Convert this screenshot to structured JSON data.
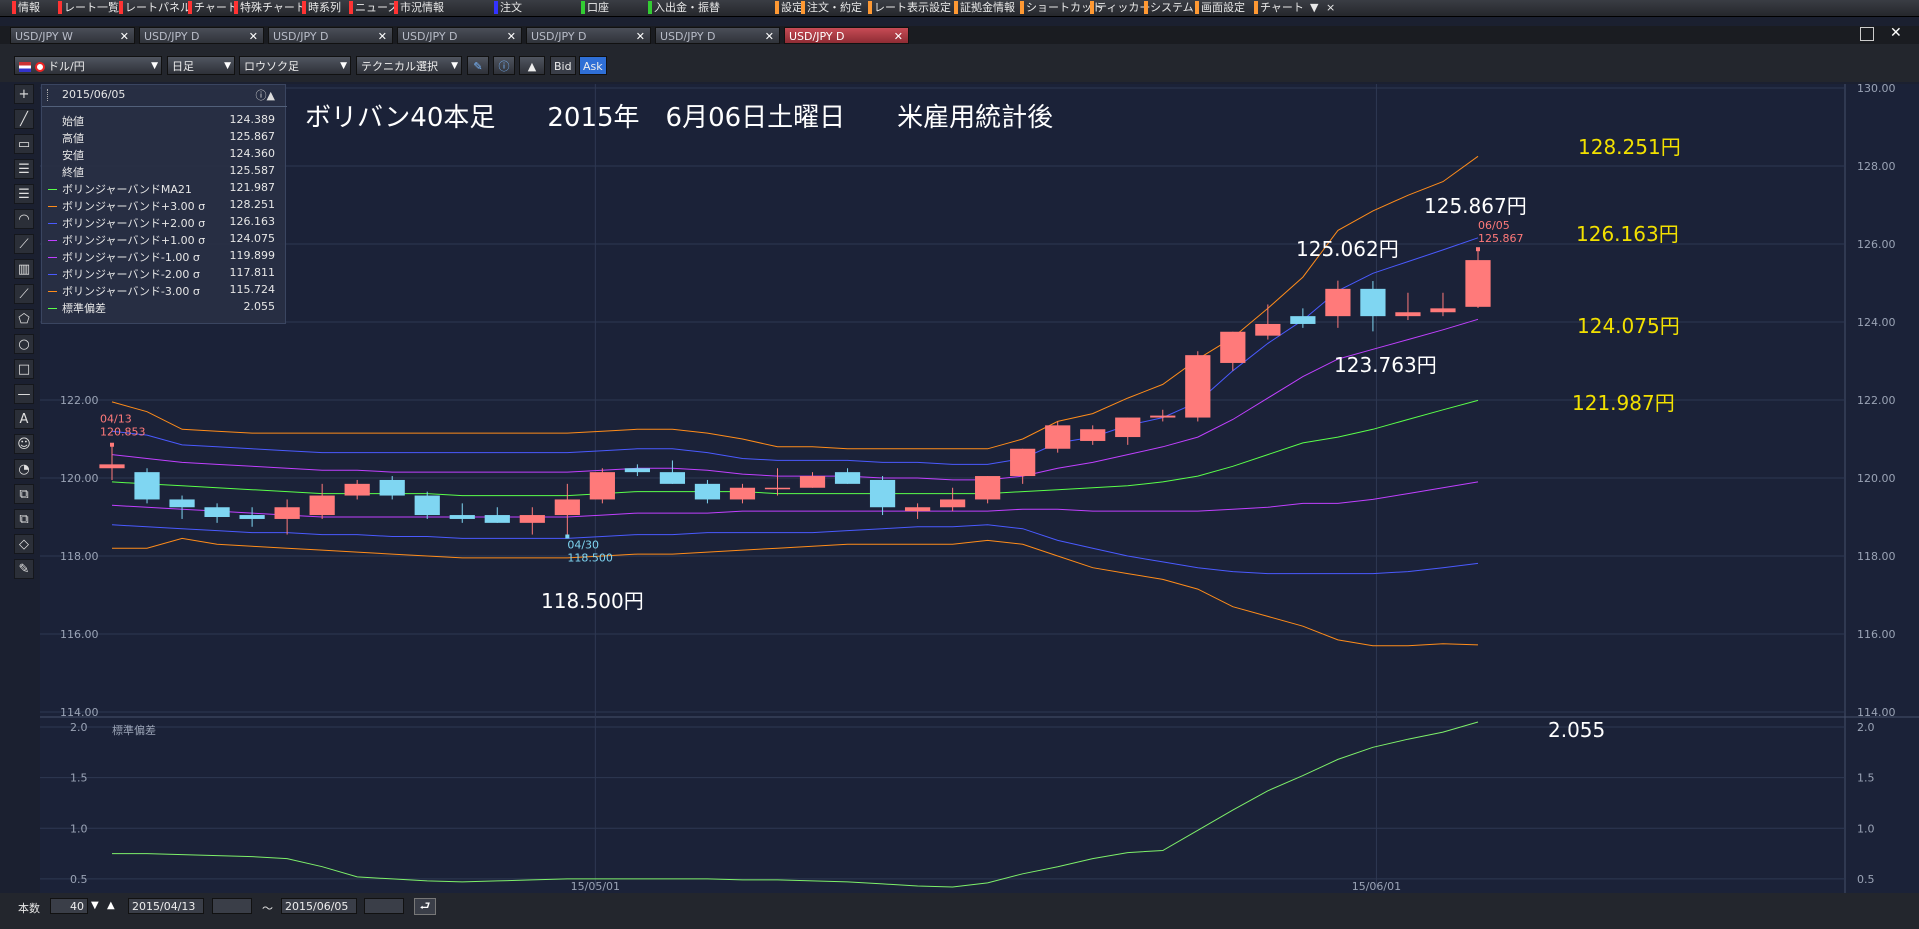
{
  "menubar": {
    "items": [
      "情報",
      "レート一覧",
      "レートパネル",
      "チャート",
      "特殊チャート",
      "時系列",
      "ニュース",
      "市況情報",
      "注文",
      "口座",
      "入出金・振替",
      "設定",
      "注文・約定",
      "レート表示設定",
      "証拠金情報",
      "ショートカット",
      "ティッカー",
      "システム",
      "画面設定",
      "チャート"
    ],
    "more_arrow": "▼",
    "close_glyph": "×"
  },
  "tabs": [
    {
      "label": "USD/JPY W"
    },
    {
      "label": "USD/JPY D"
    },
    {
      "label": "USD/JPY D"
    },
    {
      "label": "USD/JPY D"
    },
    {
      "label": "USD/JPY D"
    },
    {
      "label": "USD/JPY D"
    },
    {
      "label": "USD/JPY D",
      "active": true
    }
  ],
  "toolbar": {
    "pair": "ドル/円",
    "interval": "日足",
    "chart_type": "ロウソク足",
    "technical": "テクニカル選択",
    "bid_label": "Bid",
    "ask_label": "Ask"
  },
  "info": {
    "date": "2015/06/05",
    "rows": [
      {
        "key": "始値",
        "val": "124.389",
        "color": ""
      },
      {
        "key": "高値",
        "val": "125.867",
        "color": ""
      },
      {
        "key": "安値",
        "val": "124.360",
        "color": ""
      },
      {
        "key": "終値",
        "val": "125.587",
        "color": ""
      },
      {
        "key": "ボリンジャーバンドMA21",
        "val": "121.987",
        "color": "#5aff4a"
      },
      {
        "key": "ボリンジャーバンド+3.00 σ",
        "val": "128.251",
        "color": "#ff8c1a"
      },
      {
        "key": "ボリンジャーバンド+2.00 σ",
        "val": "126.163",
        "color": "#4a5aff"
      },
      {
        "key": "ボリンジャーバンド+1.00 σ",
        "val": "124.075",
        "color": "#c040ff"
      },
      {
        "key": "ボリンジャーバンド-1.00 σ",
        "val": "119.899",
        "color": "#c040ff"
      },
      {
        "key": "ボリンジャーバンド-2.00 σ",
        "val": "117.811",
        "color": "#4a5aff"
      },
      {
        "key": "ボリンジャーバンド-3.00 σ",
        "val": "115.724",
        "color": "#ff8c1a"
      },
      {
        "key": "標準偏差",
        "val": "2.055",
        "color": "#5aff4a"
      }
    ]
  },
  "annotations": {
    "title": "ボリバン40本足　　2015年　6月06日土曜日　　米雇用統計後",
    "p128": "128.251円",
    "p126": "126.163円",
    "p124": "124.075円",
    "p122": "121.987円",
    "p125_867": "125.867円",
    "p125_062": "125.062円",
    "p123_763": "123.763円",
    "p118_5": "118.500円",
    "sd": "2.055"
  },
  "chart_labels": {
    "high_marker": "04/13",
    "high_marker_val": "120.853",
    "low_marker": "04/30",
    "low_marker_val": "118.500",
    "last_marker": "06/05",
    "last_marker_val": "125.867",
    "sub_title": "標準偏差",
    "xlabels": [
      "15/05/01",
      "15/06/01"
    ]
  },
  "chart_data": {
    "type": "candlestick",
    "ylim": [
      114,
      130
    ],
    "yticks": [
      "130.00",
      "128.00",
      "126.00",
      "124.00",
      "122.00",
      "120.00",
      "118.00",
      "116.00",
      "114.00"
    ],
    "sub_ylim": [
      0.4,
      2.05
    ],
    "sub_yticks": [
      "2.0",
      "1.5",
      "1.0",
      "0.5"
    ],
    "candles": [
      [
        120.25,
        120.85,
        119.95,
        120.35
      ],
      [
        120.15,
        120.25,
        119.35,
        119.45
      ],
      [
        119.45,
        119.55,
        118.95,
        119.25
      ],
      [
        119.25,
        119.35,
        118.85,
        119.0
      ],
      [
        119.05,
        119.25,
        118.75,
        118.95
      ],
      [
        118.95,
        119.45,
        118.55,
        119.25
      ],
      [
        119.05,
        119.85,
        118.95,
        119.55
      ],
      [
        119.55,
        119.95,
        119.45,
        119.85
      ],
      [
        119.95,
        120.05,
        119.45,
        119.55
      ],
      [
        119.55,
        119.65,
        118.95,
        119.05
      ],
      [
        119.05,
        119.35,
        118.85,
        118.95
      ],
      [
        119.05,
        119.25,
        118.85,
        118.85
      ],
      [
        118.85,
        119.25,
        118.55,
        119.05
      ],
      [
        119.05,
        119.85,
        118.5,
        119.45
      ],
      [
        119.45,
        120.25,
        119.35,
        120.15
      ],
      [
        120.25,
        120.35,
        120.05,
        120.15
      ],
      [
        120.15,
        120.45,
        119.85,
        119.85
      ],
      [
        119.85,
        119.95,
        119.35,
        119.45
      ],
      [
        119.45,
        119.85,
        119.35,
        119.75
      ],
      [
        119.75,
        120.25,
        119.55,
        119.75
      ],
      [
        119.75,
        120.15,
        119.75,
        120.05
      ],
      [
        120.15,
        120.25,
        119.85,
        119.85
      ],
      [
        119.95,
        120.05,
        119.05,
        119.25
      ],
      [
        119.15,
        119.35,
        118.95,
        119.25
      ],
      [
        119.25,
        119.75,
        119.15,
        119.45
      ],
      [
        119.45,
        120.05,
        119.35,
        120.05
      ],
      [
        120.05,
        120.75,
        119.85,
        120.75
      ],
      [
        120.75,
        121.45,
        120.65,
        121.35
      ],
      [
        120.95,
        121.35,
        120.85,
        121.25
      ],
      [
        121.05,
        121.55,
        120.85,
        121.55
      ],
      [
        121.55,
        121.75,
        121.45,
        121.6
      ],
      [
        121.55,
        123.25,
        121.45,
        123.15
      ],
      [
        122.95,
        123.75,
        122.75,
        123.75
      ],
      [
        123.65,
        124.45,
        123.55,
        123.95
      ],
      [
        124.15,
        124.35,
        123.85,
        123.95
      ],
      [
        124.15,
        125.06,
        123.85,
        124.85
      ],
      [
        124.85,
        125.05,
        123.76,
        124.15
      ],
      [
        124.15,
        124.75,
        124.05,
        124.25
      ],
      [
        124.25,
        124.75,
        124.15,
        124.35
      ],
      [
        124.389,
        125.867,
        124.36,
        125.587
      ]
    ],
    "candle_colors": {
      "up": "#ff7a7a",
      "down": "#7fd6f2"
    },
    "bands": [
      {
        "name": "+3σ",
        "color": "#ff8c1a",
        "values": [
          121.95,
          121.7,
          121.25,
          121.2,
          121.15,
          121.15,
          121.15,
          121.15,
          121.15,
          121.15,
          121.15,
          121.15,
          121.15,
          121.15,
          121.2,
          121.25,
          121.25,
          121.15,
          121.0,
          120.8,
          120.8,
          120.75,
          120.75,
          120.75,
          120.75,
          120.75,
          121.0,
          121.45,
          121.65,
          122.05,
          122.4,
          123.05,
          123.6,
          124.35,
          125.15,
          126.35,
          126.85,
          127.25,
          127.6,
          128.25
        ]
      },
      {
        "name": "+2σ",
        "color": "#4a5aff",
        "values": [
          121.2,
          121.1,
          120.85,
          120.8,
          120.75,
          120.7,
          120.65,
          120.65,
          120.65,
          120.65,
          120.65,
          120.65,
          120.65,
          120.65,
          120.7,
          120.75,
          120.75,
          120.65,
          120.5,
          120.45,
          120.45,
          120.45,
          120.4,
          120.4,
          120.35,
          120.35,
          120.5,
          120.9,
          121.05,
          121.35,
          121.55,
          121.95,
          122.75,
          123.45,
          124.05,
          124.8,
          125.25,
          125.55,
          125.85,
          126.16
        ]
      },
      {
        "name": "+1σ",
        "color": "#c040ff",
        "values": [
          120.6,
          120.5,
          120.4,
          120.35,
          120.3,
          120.25,
          120.2,
          120.2,
          120.15,
          120.15,
          120.15,
          120.15,
          120.15,
          120.15,
          120.2,
          120.25,
          120.25,
          120.2,
          120.1,
          120.05,
          120.05,
          120.05,
          120.0,
          120.0,
          119.95,
          119.95,
          120.05,
          120.25,
          120.4,
          120.6,
          120.8,
          121.05,
          121.5,
          122.05,
          122.6,
          123.05,
          123.3,
          123.55,
          123.8,
          124.07
        ]
      },
      {
        "name": "MA21",
        "color": "#5aff4a",
        "values": [
          119.9,
          119.85,
          119.8,
          119.75,
          119.7,
          119.65,
          119.6,
          119.6,
          119.6,
          119.6,
          119.55,
          119.55,
          119.55,
          119.55,
          119.6,
          119.65,
          119.65,
          119.65,
          119.65,
          119.6,
          119.6,
          119.6,
          119.6,
          119.6,
          119.6,
          119.6,
          119.65,
          119.7,
          119.75,
          119.8,
          119.9,
          120.05,
          120.3,
          120.6,
          120.9,
          121.05,
          121.25,
          121.5,
          121.75,
          121.99
        ]
      },
      {
        "name": "-1σ",
        "color": "#c040ff",
        "values": [
          119.3,
          119.25,
          119.2,
          119.15,
          119.1,
          119.05,
          119.0,
          119.0,
          119.0,
          119.0,
          119.0,
          119.0,
          119.0,
          119.0,
          119.05,
          119.1,
          119.1,
          119.1,
          119.15,
          119.15,
          119.15,
          119.15,
          119.15,
          119.15,
          119.15,
          119.15,
          119.2,
          119.2,
          119.15,
          119.15,
          119.15,
          119.15,
          119.2,
          119.25,
          119.35,
          119.35,
          119.45,
          119.6,
          119.75,
          119.9
        ]
      },
      {
        "name": "-2σ",
        "color": "#4a5aff",
        "values": [
          118.8,
          118.75,
          118.7,
          118.65,
          118.6,
          118.6,
          118.55,
          118.55,
          118.5,
          118.5,
          118.45,
          118.45,
          118.45,
          118.45,
          118.5,
          118.55,
          118.55,
          118.6,
          118.6,
          118.6,
          118.6,
          118.65,
          118.7,
          118.75,
          118.75,
          118.8,
          118.7,
          118.4,
          118.2,
          118.0,
          117.85,
          117.7,
          117.6,
          117.55,
          117.55,
          117.55,
          117.55,
          117.6,
          117.7,
          117.81
        ]
      },
      {
        "name": "-3σ",
        "color": "#ff8c1a",
        "values": [
          118.2,
          118.2,
          118.45,
          118.3,
          118.25,
          118.2,
          118.15,
          118.1,
          118.05,
          118.0,
          117.95,
          117.95,
          117.95,
          117.95,
          118.0,
          118.05,
          118.05,
          118.1,
          118.15,
          118.2,
          118.25,
          118.3,
          118.3,
          118.3,
          118.3,
          118.4,
          118.3,
          118.0,
          117.7,
          117.55,
          117.4,
          117.15,
          116.7,
          116.45,
          116.2,
          115.85,
          115.7,
          115.7,
          115.75,
          115.72
        ]
      }
    ],
    "stddev": [
      0.75,
      0.75,
      0.74,
      0.73,
      0.72,
      0.7,
      0.62,
      0.52,
      0.5,
      0.48,
      0.47,
      0.48,
      0.49,
      0.5,
      0.5,
      0.5,
      0.5,
      0.5,
      0.49,
      0.49,
      0.48,
      0.47,
      0.45,
      0.43,
      0.42,
      0.46,
      0.55,
      0.62,
      0.7,
      0.76,
      0.78,
      0.98,
      1.18,
      1.37,
      1.52,
      1.68,
      1.8,
      1.88,
      1.95,
      2.05
    ]
  },
  "bottombar": {
    "label_count": "本数",
    "count": "40",
    "start": "2015/04/13",
    "tilde": "〜",
    "end": "2015/06/05"
  }
}
